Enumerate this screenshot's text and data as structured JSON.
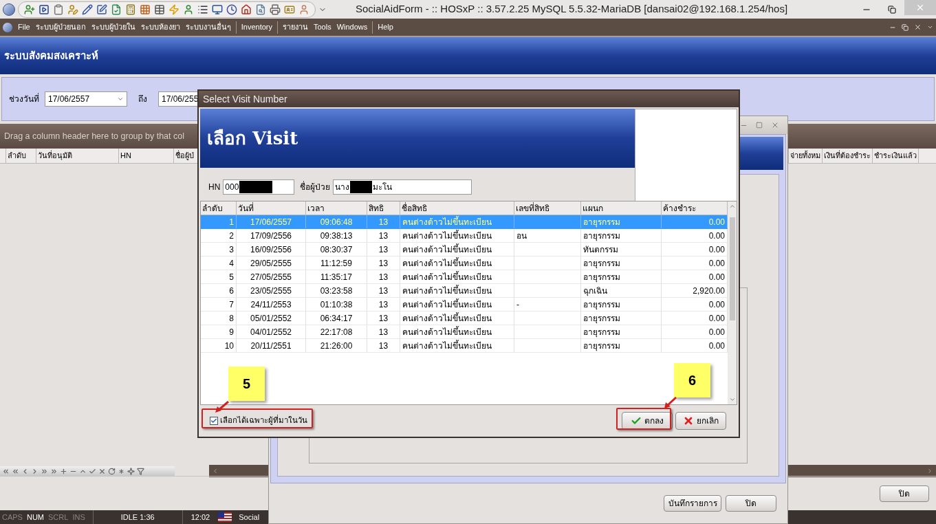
{
  "window": {
    "title": "SocialAidForm - :: HOSxP :: 3.57.2.25 MySQL 5.5.32-MariaDB [dansai02@192.168.1.254/hos]"
  },
  "menu": [
    {
      "label": "File",
      "separator_before": false
    },
    {
      "label": "ระบบผู้ป่วยนอก",
      "separator_before": false
    },
    {
      "label": "ระบบผู้ป่วยใน",
      "separator_before": false
    },
    {
      "label": "ระบบห้องยา",
      "separator_before": false
    },
    {
      "label": "ระบบงานอื่นๆ",
      "separator_before": false
    },
    {
      "label": "Inventory",
      "separator_before": true
    },
    {
      "label": "รายงาน",
      "separator_before": true
    },
    {
      "label": "Tools",
      "separator_before": false
    },
    {
      "label": "Windows",
      "separator_before": false
    },
    {
      "label": "Help",
      "separator_before": true
    }
  ],
  "page_title": "ระบบสังคมสงเคราะห์",
  "filter": {
    "label": "ช่วงวันที่",
    "from": "17/06/2557",
    "to_label": "ถึง",
    "to": "17/06/255"
  },
  "group_hint": "Drag a column header here to group by that col",
  "grid": {
    "columns_left": [
      "ลำดับ",
      "วันที่อนุมัติ",
      "HN",
      "ชื่อผู้ป่"
    ],
    "columns_right": [
      "จ่ายทั้งหม",
      "เงินที่ต้องชำระ",
      "ชำระเงินแล้ว"
    ]
  },
  "close_button": "ปิด",
  "status_bar": {
    "keys": [
      {
        "label": "CAPS",
        "on": false
      },
      {
        "label": "NUM",
        "on": true
      },
      {
        "label": "SCRL",
        "on": false
      },
      {
        "label": "INS",
        "on": false
      }
    ],
    "idle": "IDLE 1:36",
    "time": "12:02",
    "task": "Social"
  },
  "form_window": {
    "buttons": [
      "บันทึกรายการ",
      "ปิด"
    ]
  },
  "dialog": {
    "title": "Select Visit Number",
    "heading": "เลือก Visit",
    "hn_label": "HN",
    "hn": "000",
    "name_label": "ชื่อผู้ป่วย",
    "name_prefix": "นาง",
    "name_suffix": "มะโน",
    "columns": [
      "ลำดับ",
      "วันที่",
      "เวลา",
      "สิทธิ",
      "ชื่อสิทธิ",
      "เลขที่สิทธิ",
      "แผนก",
      "ค้างชำระ"
    ],
    "rows": [
      {
        "cells": [
          "1",
          "17/06/2557",
          "09:06:48",
          "13",
          "คนต่างด้าวไม่ขึ้นทะเบียน",
          "",
          "อายุรกรรม",
          "0.00"
        ],
        "selected": true
      },
      {
        "cells": [
          "2",
          "17/09/2556",
          "09:38:13",
          "13",
          "คนต่างด้าวไม่ขึ้นทะเบียน",
          "อน",
          "อายุรกรรม",
          "0.00"
        ],
        "selected": false
      },
      {
        "cells": [
          "3",
          "16/09/2556",
          "08:30:37",
          "13",
          "คนต่างด้าวไม่ขึ้นทะเบียน",
          "",
          "ทันตกรรม",
          "0.00"
        ],
        "selected": false
      },
      {
        "cells": [
          "4",
          "29/05/2555",
          "11:12:59",
          "13",
          "คนต่างด้าวไม่ขึ้นทะเบียน",
          "",
          "อายุรกรรม",
          "0.00"
        ],
        "selected": false
      },
      {
        "cells": [
          "5",
          "27/05/2555",
          "11:35:17",
          "13",
          "คนต่างด้าวไม่ขึ้นทะเบียน",
          "",
          "อายุรกรรม",
          "0.00"
        ],
        "selected": false
      },
      {
        "cells": [
          "6",
          "23/05/2555",
          "03:23:58",
          "13",
          "คนต่างด้าวไม่ขึ้นทะเบียน",
          "",
          "ฉุกเฉิน",
          "2,920.00"
        ],
        "selected": false
      },
      {
        "cells": [
          "7",
          "24/11/2553",
          "01:10:38",
          "13",
          "คนต่างด้าวไม่ขึ้นทะเบียน",
          "-",
          "อายุรกรรม",
          "0.00"
        ],
        "selected": false
      },
      {
        "cells": [
          "8",
          "05/01/2552",
          "06:34:17",
          "13",
          "คนต่างด้าวไม่ขึ้นทะเบียน",
          "",
          "อายุรกรรม",
          "0.00"
        ],
        "selected": false
      },
      {
        "cells": [
          "9",
          "04/01/2552",
          "22:17:08",
          "13",
          "คนต่างด้าวไม่ขึ้นทะเบียน",
          "",
          "อายุรกรรม",
          "0.00"
        ],
        "selected": false
      },
      {
        "cells": [
          "10",
          "20/11/2551",
          "21:26:00",
          "13",
          "คนต่างด้าวไม่ขึ้นทะเบียน",
          "",
          "อายุรกรรม",
          "0.00"
        ],
        "selected": false
      }
    ],
    "only_today": {
      "label": "เลือกได้เฉพาะผู้ที่มาในวัน",
      "checked": true
    },
    "ok": "ตกลง",
    "cancel": "ยกเลิก"
  },
  "annotations": [
    {
      "number": "5"
    },
    {
      "number": "6"
    }
  ]
}
